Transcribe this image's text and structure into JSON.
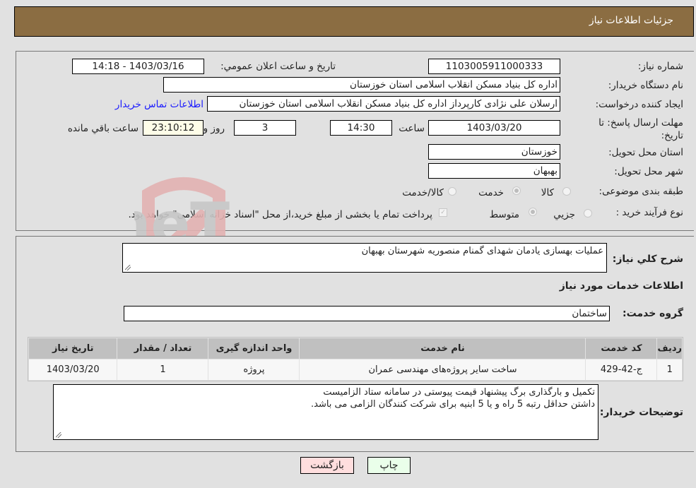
{
  "header": {
    "title": "جزئیات اطلاعات نیاز"
  },
  "details": {
    "need_number_label": "شماره نیاز:",
    "need_number": "1103005911000333",
    "announce_label": "تاریخ و ساعت اعلان عمومي:",
    "announce_value": "1403/03/16 - 14:18",
    "buyer_org_label": "نام دستگاه خريدار:",
    "buyer_org": "اداره کل بنیاد مسکن انقلاب اسلامی استان خوزستان",
    "creator_label": "ایجاد کننده درخواست:",
    "creator": "ارسلان علی نژادی کارپرداز اداره کل بنیاد مسکن انقلاب اسلامی استان خوزستان",
    "contact_link": "اطلاعات تماس خريدار",
    "deadline_label": "مهلت ارسال پاسخ: تا تاریخ:",
    "deadline_date": "1403/03/20",
    "time_label": "ساعت",
    "deadline_time": "14:30",
    "days_value": "3",
    "days_label": "روز و",
    "remaining_time": "23:10:12",
    "remaining_label": "ساعت باقي مانده",
    "province_label": "استان محل تحویل:",
    "province": "خوزستان",
    "city_label": "شهر محل تحویل:",
    "city": "بهبهان",
    "category_label": "طبقه بندی موضوعی:",
    "category_options": [
      {
        "label": "کالا",
        "checked": false
      },
      {
        "label": "خدمت",
        "checked": true
      },
      {
        "label": "کالا/خدمت",
        "checked": false
      }
    ],
    "process_label": "نوع فرآیند خرید :",
    "process_options": [
      {
        "label": "جزيي",
        "checked": false
      },
      {
        "label": "متوسط",
        "checked": true
      }
    ],
    "treasury_checkbox_checked": true,
    "treasury_text": "پرداخت تمام یا بخشی از مبلغ خرید،از محل \"اسناد خزانه اسلامی\" خواهد بود."
  },
  "summary": {
    "description_label": "شرح کلي نياز:",
    "description": "عملیات بهسازی یادمان شهدای گمنام منصوریه شهرستان بهبهان",
    "services_title": "اطلاعات خدمات مورد نياز",
    "service_group_label": "گروه خدمت:",
    "service_group": "ساختمان"
  },
  "table": {
    "headers": [
      "رديف",
      "کد خدمت",
      "نام خدمت",
      "واحد اندازه گيری",
      "تعداد / مقدار",
      "تاريخ نياز"
    ],
    "rows": [
      [
        "1",
        "ج-42-429",
        "ساخت سایر پروژه‌های مهندسی عمران",
        "پروژه",
        "1",
        "1403/03/20"
      ]
    ]
  },
  "notes": {
    "label": "توضيحات خريدار:",
    "line1": "تکمیل و بارگذاری برگ پیشنهاد قیمت پیوستی در سامانه ستاد الزامیست",
    "line2": "داشتن حداقل رتبه 5 راه و یا 5  ابنیه برای شرکت کنندگان الزامی می باشد."
  },
  "buttons": {
    "print": "چاپ",
    "back": "بازگشت"
  },
  "watermark": {
    "text": "AriaTender.neT"
  },
  "colors": {
    "header_bg": "#8b6d42",
    "page_bg": "#e1e1e1",
    "link": "#1a1aff",
    "print_bg": "#eaffea",
    "back_bg": "#ffdede",
    "remaining_bg": "#fefde8"
  }
}
